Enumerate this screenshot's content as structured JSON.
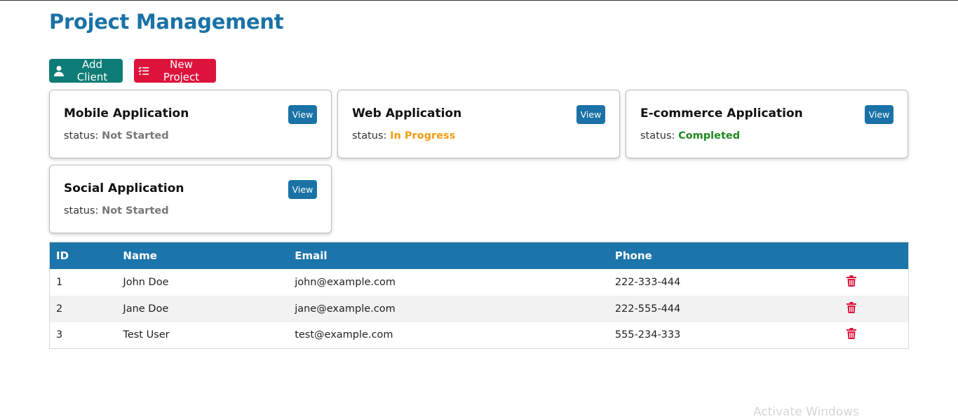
{
  "page": {
    "title": "Project Management"
  },
  "actions": {
    "add_client": "Add Client",
    "new_project": "New Project"
  },
  "colors": {
    "title": "#1a72a6",
    "add_client_btn": "#0e7c76",
    "new_project_btn": "#dc143c",
    "view_btn": "#1a72a6",
    "table_header": "#1b74aa",
    "delete_icon": "#dc143c",
    "status_not_started": "#777777",
    "status_in_progress": "#f39c12",
    "status_completed": "#218a21"
  },
  "projects": [
    {
      "name": "Mobile Application",
      "status_label": "status:",
      "status": "Not Started",
      "view": "View"
    },
    {
      "name": "Web Application",
      "status_label": "status:",
      "status": "In Progress",
      "view": "View"
    },
    {
      "name": "E-commerce Application",
      "status_label": "status:",
      "status": "Completed",
      "view": "View"
    },
    {
      "name": "Social Application",
      "status_label": "status:",
      "status": "Not Started",
      "view": "View"
    }
  ],
  "table": {
    "headers": [
      "ID",
      "Name",
      "Email",
      "Phone",
      ""
    ],
    "rows": [
      {
        "id": "1",
        "name": "John Doe",
        "email": "john@example.com",
        "phone": "222-333-444",
        "icon": "trash-icon"
      },
      {
        "id": "2",
        "name": "Jane Doe",
        "email": "jane@example.com",
        "phone": "222-555-444",
        "icon": "trash-icon"
      },
      {
        "id": "3",
        "name": "Test User",
        "email": "test@example.com",
        "phone": "555-234-333",
        "icon": "trash-icon"
      }
    ]
  },
  "watermark": "Activate Windows"
}
